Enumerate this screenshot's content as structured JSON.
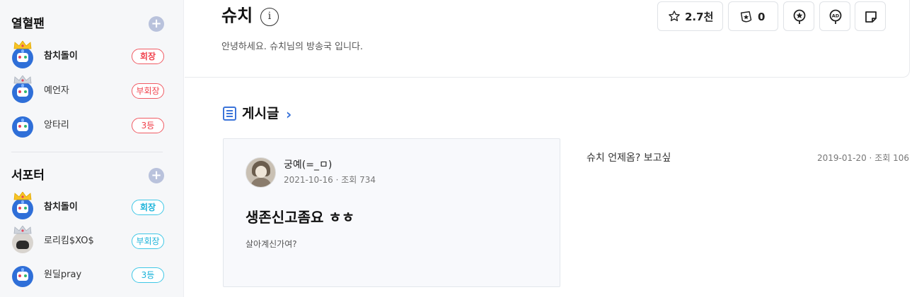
{
  "sidebar": {
    "sections": [
      {
        "title": "열혈팬",
        "members": [
          {
            "name": "참치돌이",
            "badge": "회장",
            "crown": "gold"
          },
          {
            "name": "예언자",
            "badge": "부회장",
            "crown": "silver"
          },
          {
            "name": "앙타리",
            "badge": "3등",
            "crown": "none"
          }
        ]
      },
      {
        "title": "서포터",
        "members": [
          {
            "name": "참치돌이",
            "badge": "회장",
            "crown": "gold"
          },
          {
            "name": "로리킴$XO$",
            "badge": "부회장",
            "crown": "silver"
          },
          {
            "name": "원딜pray",
            "badge": "3등",
            "crown": "none"
          }
        ]
      }
    ],
    "colors": {
      "fan_badge": "#f0414c",
      "supporter_badge": "#18b2d9",
      "plus": "#b9c2dc"
    }
  },
  "channel": {
    "name": "슈치",
    "info_glyph": "i",
    "description": "안녕하세요. 슈치님의 방송국 입니다.",
    "favorite_count": "2.7천",
    "subscribe_count": "0",
    "icons": [
      "star-icon",
      "subscribe-badge-icon",
      "vip-star-icon",
      "ad-balloon-icon",
      "sticker-icon"
    ]
  },
  "posts": {
    "section_title": "게시글",
    "chevron": "›",
    "featured": {
      "author": "궁예(=_ㅁ)",
      "date": "2021-10-16",
      "views": "조회 734",
      "title": "생존신고좀요 ㅎㅎ",
      "excerpt": "살아계신가여?"
    },
    "side": {
      "title": "슈치 언제옴? 보고싶",
      "date": "2019-01-20",
      "views": "조회 106"
    },
    "meta_separator": " · ",
    "accent": "#3b74d9"
  }
}
